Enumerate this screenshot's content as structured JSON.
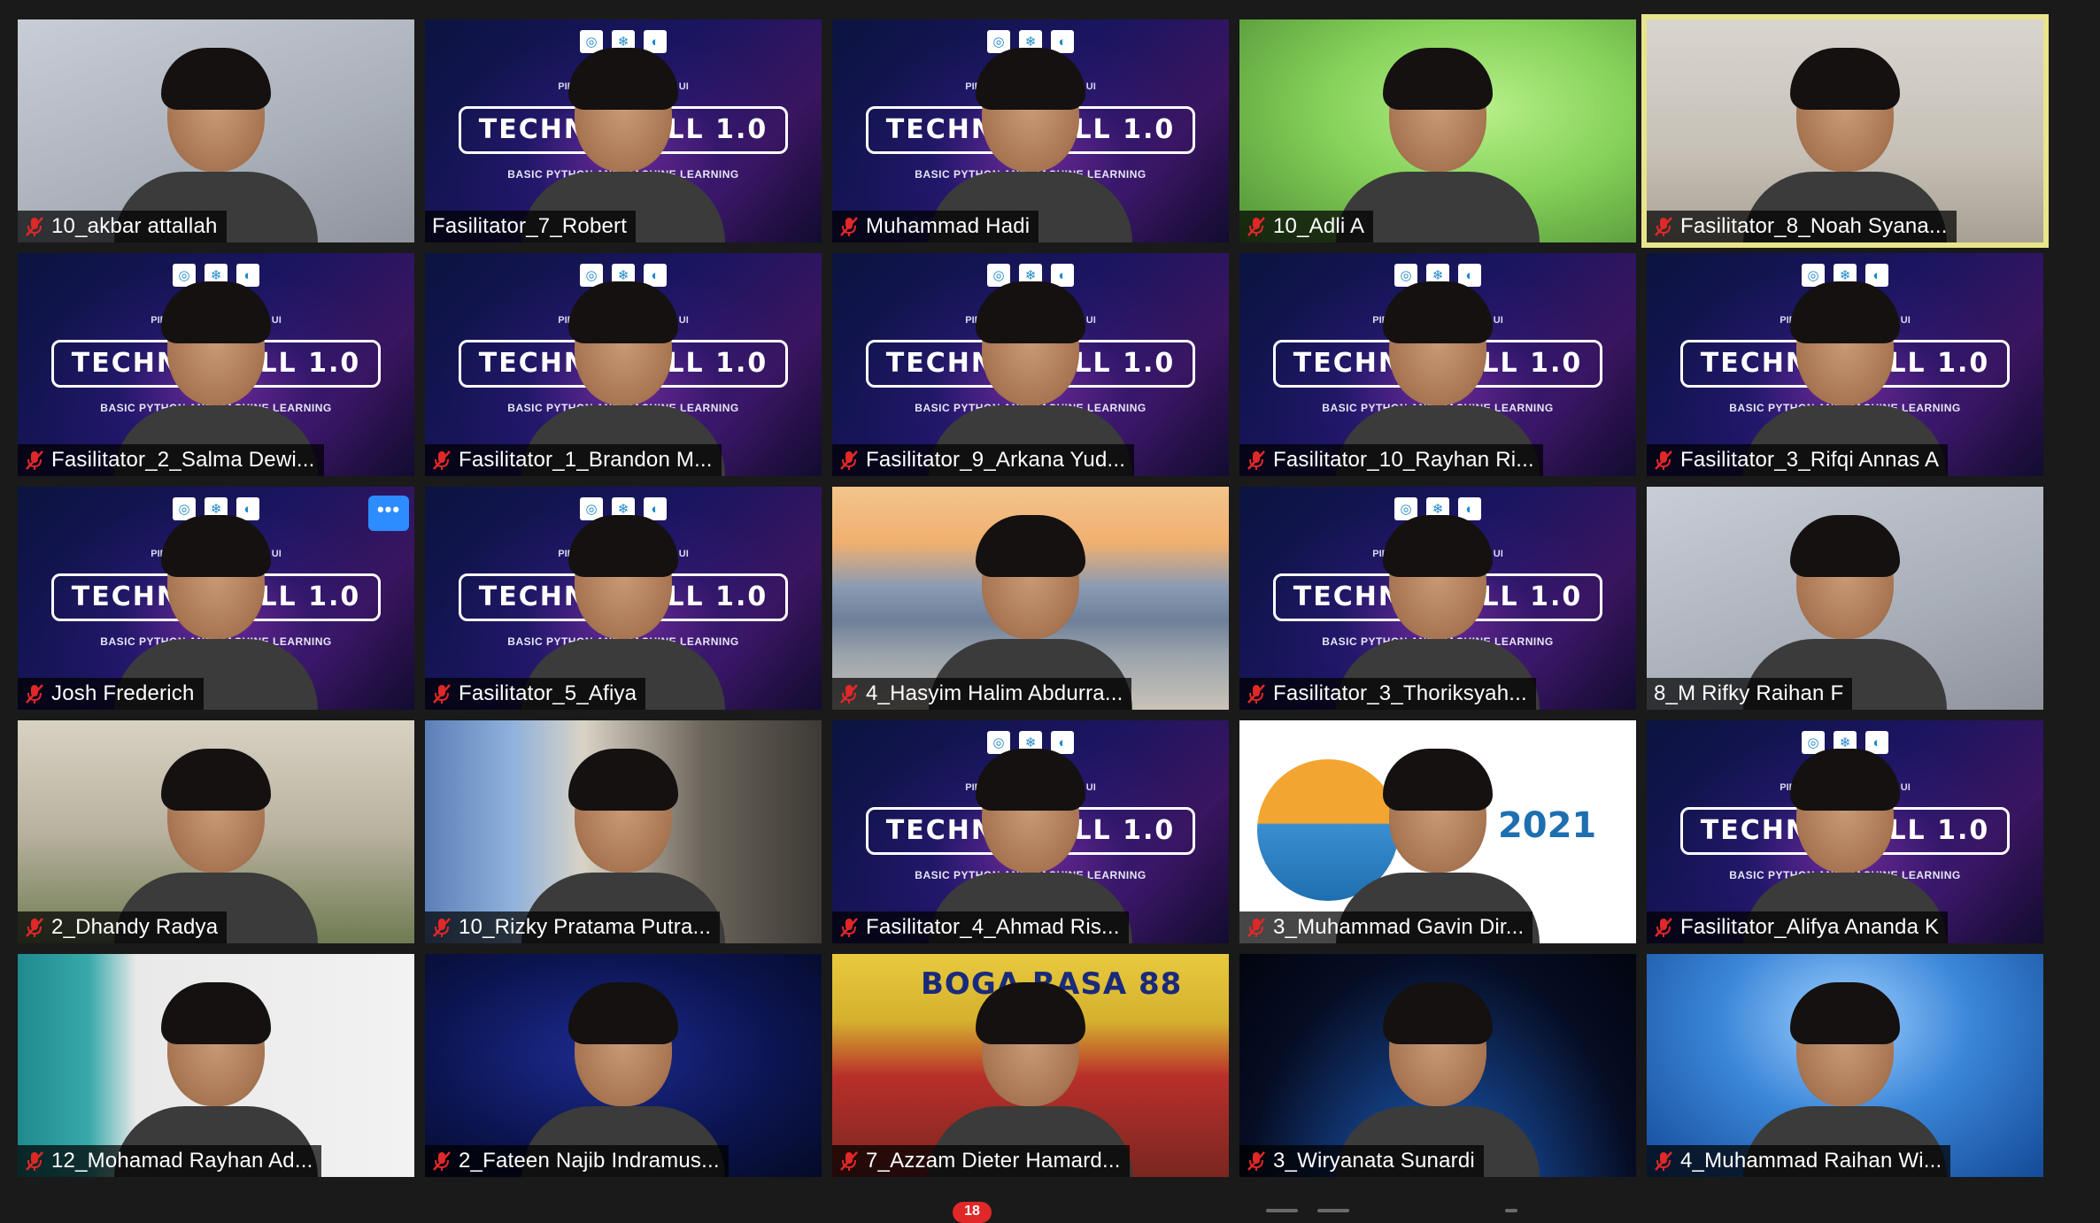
{
  "meeting": {
    "chat_unread_count": "18",
    "more_options_label": "•••"
  },
  "colors": {
    "active_speaker_border": "#e8e58a",
    "more_button": "#2d8cff",
    "mute_icon": "#e02828",
    "badge": "#e02828"
  },
  "banner": {
    "title": "TECHNOSKILL 1.0",
    "subtitle": "BASIC PYTHON AND MACHINE LEARNING",
    "presenter": "PIPTEK IME FTUI X ASBE UI"
  },
  "participants": [
    {
      "name": "10_akbar attallah",
      "muted": true,
      "bg": "wall"
    },
    {
      "name": "Fasilitator_7_Robert",
      "muted": false,
      "bg": "banner"
    },
    {
      "name": "Muhammad Hadi",
      "muted": true,
      "bg": "banner"
    },
    {
      "name": "10_Adli A",
      "muted": true,
      "bg": "green"
    },
    {
      "name": "Fasilitator_8_Noah Syana...",
      "muted": true,
      "bg": "room",
      "active": true
    },
    {
      "name": "Fasilitator_2_Salma Dewi...",
      "muted": true,
      "bg": "banner"
    },
    {
      "name": "Fasilitator_1_Brandon M...",
      "muted": true,
      "bg": "banner"
    },
    {
      "name": "Fasilitator_9_Arkana Yud...",
      "muted": true,
      "bg": "banner"
    },
    {
      "name": "Fasilitator_10_Rayhan Ri...",
      "muted": true,
      "bg": "banner"
    },
    {
      "name": "Fasilitator_3_Rifqi Annas A",
      "muted": true,
      "bg": "banner"
    },
    {
      "name": "Josh Frederich",
      "muted": true,
      "bg": "banner",
      "has_more_button": true
    },
    {
      "name": "Fasilitator_5_Afiya",
      "muted": true,
      "bg": "banner"
    },
    {
      "name": "4_Hasyim Halim Abdurra...",
      "muted": true,
      "bg": "bridge"
    },
    {
      "name": "Fasilitator_3_Thoriksyah...",
      "muted": true,
      "bg": "banner"
    },
    {
      "name": "8_M Rifky Raihan F",
      "muted": false,
      "bg": "wall"
    },
    {
      "name": "2_Dhandy Radya",
      "muted": true,
      "bg": "tower"
    },
    {
      "name": "10_Rizky Pratama Putra...",
      "muted": true,
      "bg": "curtain"
    },
    {
      "name": "Fasilitator_4_Ahmad Ris...",
      "muted": true,
      "bg": "banner"
    },
    {
      "name": "3_Muhammad Gavin Dir...",
      "muted": true,
      "bg": "logo"
    },
    {
      "name": "Fasilitator_Alifya Ananda K",
      "muted": true,
      "bg": "banner"
    },
    {
      "name": "12_Mohamad Rayhan Ad...",
      "muted": true,
      "bg": "teal"
    },
    {
      "name": "2_Fateen Najib Indramus...",
      "muted": true,
      "bg": "navy"
    },
    {
      "name": "7_Azzam Dieter Hamard...",
      "muted": true,
      "bg": "shop"
    },
    {
      "name": "3_Wiryanata Sunardi",
      "muted": true,
      "bg": "space"
    },
    {
      "name": "4_Muhammad Raihan Wi...",
      "muted": true,
      "bg": "sky"
    }
  ],
  "virtual_bg_text": {
    "logo_event": "IMF 2021",
    "shop_sign": "BOGA RASA 88"
  }
}
